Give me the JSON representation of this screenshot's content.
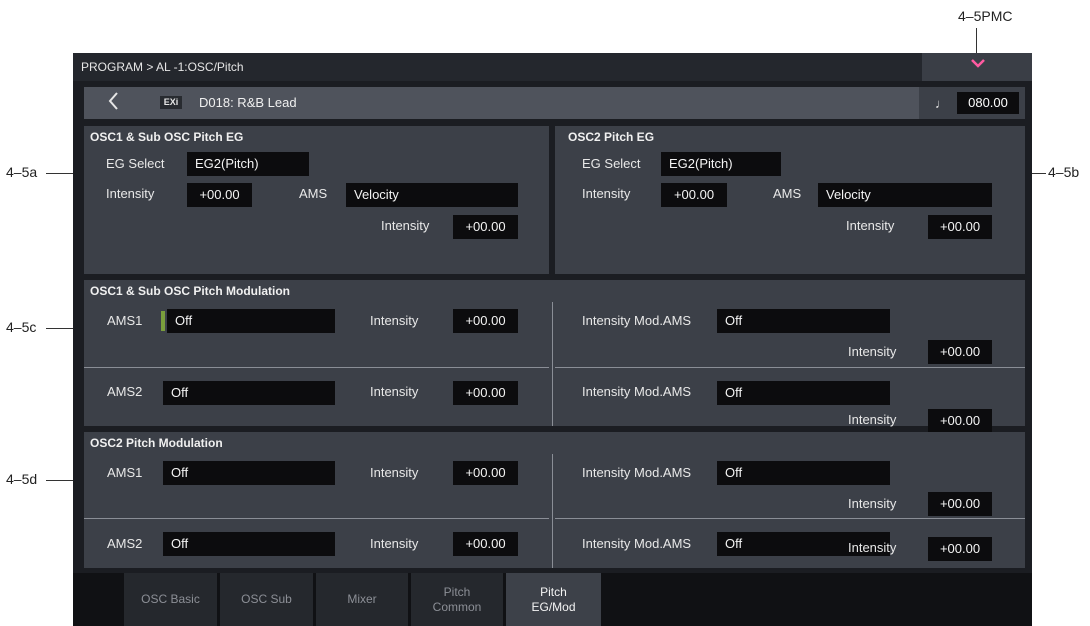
{
  "callouts": {
    "top_right": "4–5PMC",
    "a": "4–5a",
    "b": "4–5b",
    "c": "4–5c",
    "d": "4–5d"
  },
  "titlebar": {
    "breadcrumb": "PROGRAM > AL -1:OSC/Pitch",
    "menu_icon": "chevron-down-icon",
    "accent": "#ff5aa0"
  },
  "program": {
    "back_icon": "chevron-left-icon",
    "badge": "EXi",
    "name": "D018: R&B Lead",
    "tempo_icon": "quarter-note-icon",
    "tempo": "080.00"
  },
  "osc1_eg": {
    "title": "OSC1 & Sub OSC Pitch EG",
    "eg_select_label": "EG Select",
    "eg_select": "EG2(Pitch)",
    "intensity_label": "Intensity",
    "intensity": "+00.00",
    "ams_label": "AMS",
    "ams": "Velocity",
    "ams_intensity_label": "Intensity",
    "ams_intensity": "+00.00"
  },
  "osc2_eg": {
    "title": "OSC2 Pitch EG",
    "eg_select_label": "EG Select",
    "eg_select": "EG2(Pitch)",
    "intensity_label": "Intensity",
    "intensity": "+00.00",
    "ams_label": "AMS",
    "ams": "Velocity",
    "ams_intensity_label": "Intensity",
    "ams_intensity": "+00.00"
  },
  "osc1_mod": {
    "title": "OSC1 & Sub OSC Pitch Modulation",
    "rows": [
      {
        "ams_label": "AMS1",
        "ams": "Off",
        "intensity_label": "Intensity",
        "intensity": "+00.00",
        "mod_label": "Intensity Mod.AMS",
        "mod": "Off",
        "mod_int_label": "Intensity",
        "mod_int": "+00.00"
      },
      {
        "ams_label": "AMS2",
        "ams": "Off",
        "intensity_label": "Intensity",
        "intensity": "+00.00",
        "mod_label": "Intensity Mod.AMS",
        "mod": "Off",
        "mod_int_label": "Intensity",
        "mod_int": "+00.00"
      }
    ]
  },
  "osc2_mod": {
    "title": "OSC2 Pitch Modulation",
    "rows": [
      {
        "ams_label": "AMS1",
        "ams": "Off",
        "intensity_label": "Intensity",
        "intensity": "+00.00",
        "mod_label": "Intensity Mod.AMS",
        "mod": "Off",
        "mod_int_label": "Intensity",
        "mod_int": "+00.00"
      },
      {
        "ams_label": "AMS2",
        "ams": "Off",
        "intensity_label": "Intensity",
        "intensity": "+00.00",
        "mod_label": "Intensity Mod.AMS",
        "mod": "Off",
        "mod_int_label": "Intensity",
        "mod_int": "+00.00"
      }
    ]
  },
  "tabs": [
    {
      "label": "OSC Basic"
    },
    {
      "label": "OSC Sub"
    },
    {
      "label": "Mixer"
    },
    {
      "label": "Pitch\nCommon"
    },
    {
      "label": "Pitch\nEG/Mod",
      "active": true
    }
  ]
}
